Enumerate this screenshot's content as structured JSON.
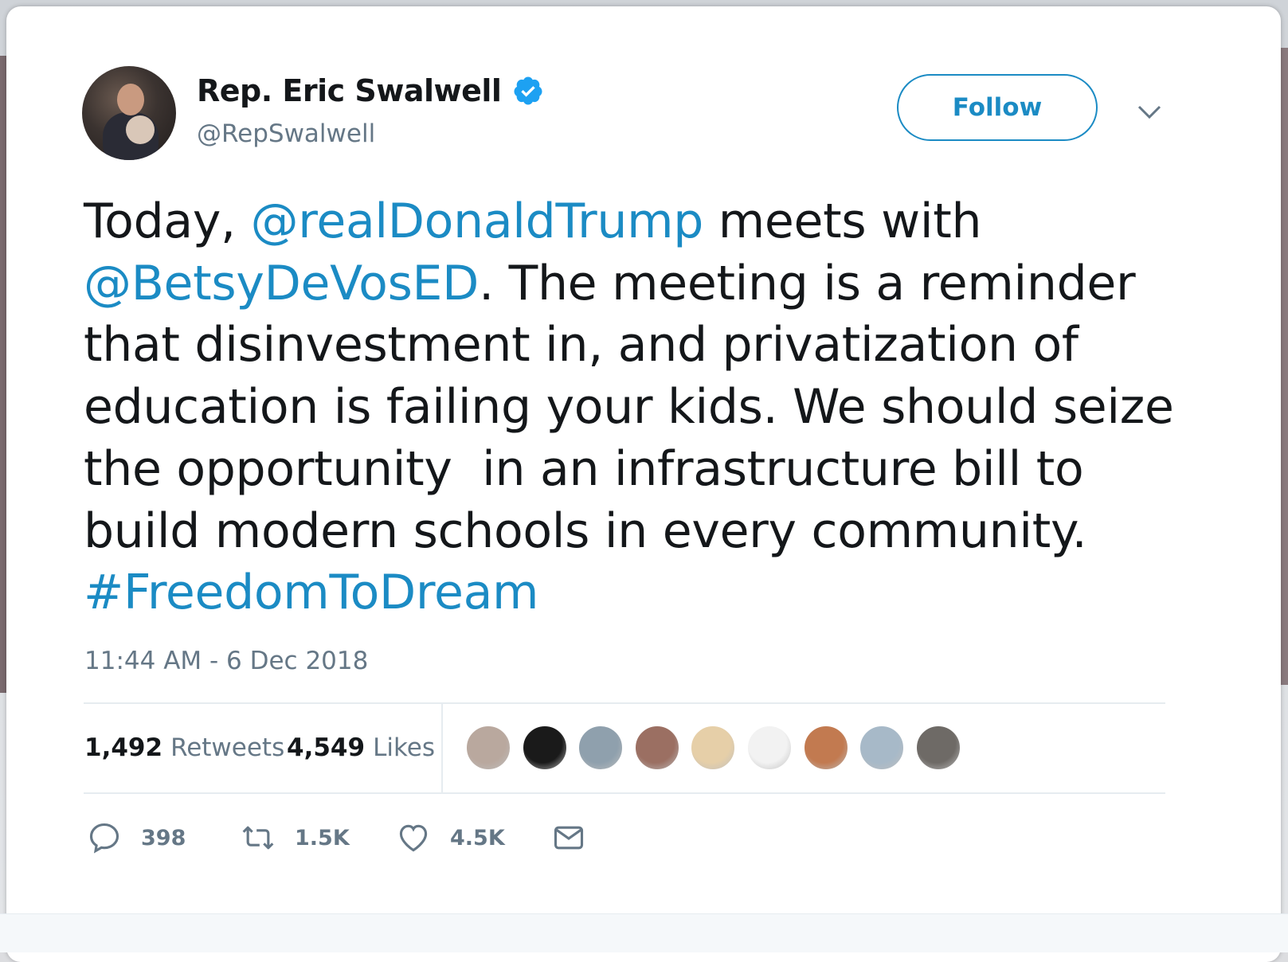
{
  "user": {
    "display_name": "Rep. Eric Swalwell",
    "handle": "@RepSwalwell",
    "verified": true,
    "avatar_icon": "profile-photo"
  },
  "follow_label": "Follow",
  "tweet": {
    "segments": [
      {
        "text": "Today, ",
        "link": false
      },
      {
        "text": "@realDonaldTrump",
        "link": true
      },
      {
        "text": " meets with\n",
        "link": false
      },
      {
        "text": "@BetsyDeVosED",
        "link": true
      },
      {
        "text": ". The meeting is a reminder\nthat disinvestment in, and privatization of\neducation is failing your kids. We should seize\nthe opportunity  in an infrastructure bill to\nbuild modern schools in every community.\n",
        "link": false
      },
      {
        "text": "#FreedomToDream",
        "link": true
      }
    ],
    "timestamp": "11:44 AM - 6 Dec 2018"
  },
  "stats": {
    "retweets_count": "1,492",
    "retweets_label": "Retweets",
    "likes_count": "4,549",
    "likes_label": "Likes"
  },
  "liker_avatar_colors": [
    "#b9a89e",
    "#1a1a1a",
    "#8fa0ad",
    "#9b6f62",
    "#e6cfa8",
    "#f2f2f2",
    "#c27a50",
    "#a7b9c8",
    "#6e6a66"
  ],
  "actions": {
    "reply_count": "398",
    "retweet_count": "1.5K",
    "like_count": "4.5K"
  },
  "colors": {
    "link": "#1b8bc4",
    "text": "#14171a",
    "secondary": "#657786",
    "verified": "#1da1f2"
  }
}
